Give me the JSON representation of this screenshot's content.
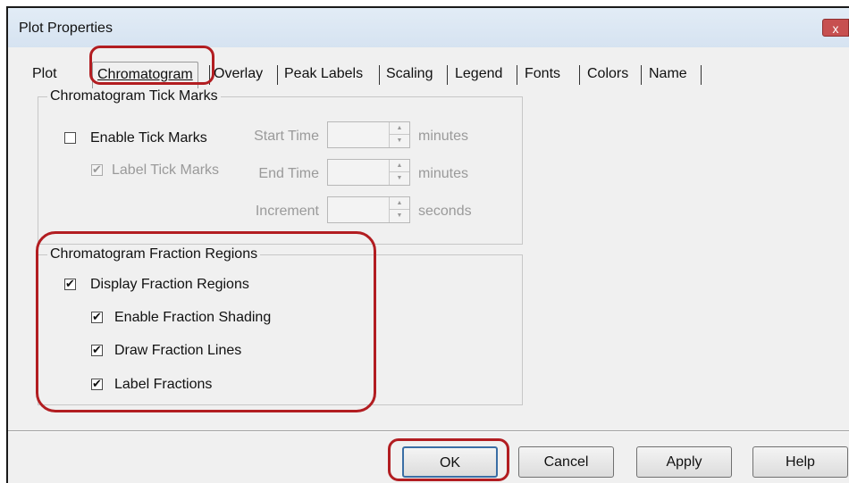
{
  "window": {
    "title": "Plot Properties",
    "close_label": "x"
  },
  "tabs": [
    {
      "label": "Plot"
    },
    {
      "label": "Chromatogram",
      "active": true
    },
    {
      "label": "Overlay"
    },
    {
      "label": "Peak Labels"
    },
    {
      "label": "Scaling"
    },
    {
      "label": "Legend"
    },
    {
      "label": "Fonts"
    },
    {
      "label": "Colors"
    },
    {
      "label": "Name"
    }
  ],
  "tick_marks": {
    "group_label": "Chromatogram Tick Marks",
    "enable": {
      "label": "Enable Tick Marks",
      "checked": false
    },
    "label_ticks": {
      "label": "Label Tick Marks",
      "checked": true,
      "enabled": false
    },
    "start_time": {
      "label": "Start Time",
      "value": "",
      "unit": "minutes"
    },
    "end_time": {
      "label": "End Time",
      "value": "",
      "unit": "minutes"
    },
    "increment": {
      "label": "Increment",
      "value": "",
      "unit": "seconds"
    }
  },
  "fraction_regions": {
    "group_label": "Chromatogram Fraction Regions",
    "display": {
      "label": "Display Fraction Regions",
      "checked": true
    },
    "shading": {
      "label": "Enable Fraction Shading",
      "checked": true
    },
    "lines": {
      "label": "Draw Fraction Lines",
      "checked": true
    },
    "labels": {
      "label": "Label Fractions",
      "checked": true
    }
  },
  "buttons": {
    "ok": "OK",
    "cancel": "Cancel",
    "apply": "Apply",
    "help": "Help"
  },
  "colors": {
    "highlight": "#b21d21",
    "titlebar": "#d6e3f1"
  }
}
